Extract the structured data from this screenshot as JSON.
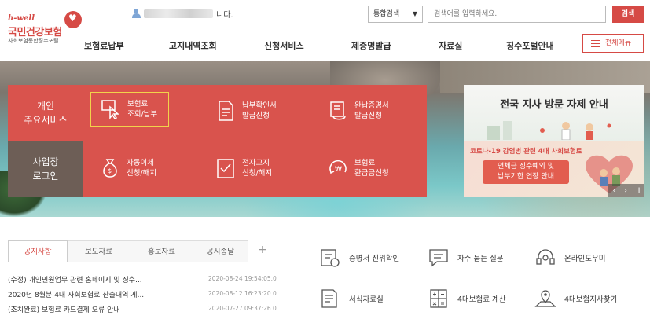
{
  "logo": {
    "brand_en": "h-well",
    "name": "국민건강보험",
    "subtitle": "사회보험통합징수포털"
  },
  "user": {
    "suffix": "니다."
  },
  "search": {
    "scope": "통합검색",
    "placeholder": "검색어를 입력하세요.",
    "button": "검색"
  },
  "nav": {
    "items": [
      "보험료납부",
      "고지내역조회",
      "신청서비스",
      "제증명발급",
      "자료실",
      "징수포털안내"
    ],
    "menu_button": "전체메뉴"
  },
  "personal": {
    "label_line1": "개인",
    "label_line2": "주요서비스",
    "services": [
      {
        "line1": "보험료",
        "line2": "조회/납부",
        "icon": "cursor-click-icon"
      },
      {
        "line1": "납부확인서",
        "line2": "발급신청",
        "icon": "document-icon"
      },
      {
        "line1": "완납증명서",
        "line2": "발급신청",
        "icon": "certificate-scroll-icon"
      }
    ]
  },
  "business": {
    "label_line1": "사업장",
    "label_line2": "로그인",
    "services": [
      {
        "line1": "자동이체",
        "line2": "신청/해지",
        "icon": "money-bag-icon"
      },
      {
        "line1": "전자고지",
        "line2": "신청/해지",
        "icon": "checklist-icon"
      },
      {
        "line1": "보험료",
        "line2": "환급금신청",
        "icon": "refund-icon"
      }
    ]
  },
  "banner": {
    "title": "전국 지사 방문 자제 안내",
    "subtitle": "코로나-19 감염병 관련 4대 사회보험료",
    "body_line1": "연체금 징수예외 및",
    "body_line2": "납부기한 연장 안내",
    "controls": {
      "prev": "‹",
      "next": "›",
      "pause": "II"
    }
  },
  "tabs": [
    "공지사항",
    "보도자료",
    "홍보자료",
    "공시송달"
  ],
  "tab_add": "+",
  "news": [
    {
      "title": "(수정) 개인민원업무 관련 홈페이지 및 징수...",
      "date": "2020-08-24 19:54:05.0"
    },
    {
      "title": "2020년 8월분 4대 사회보험료 산출내역 게...",
      "date": "2020-08-12 16:23:20.0"
    },
    {
      "title": "(조치완료) 보험료 카드결제 오류 안내",
      "date": "2020-07-27 09:37:26.0"
    }
  ],
  "quick_links": [
    {
      "label": "증명서 진위확인",
      "icon": "certificate-check-icon"
    },
    {
      "label": "자주 묻는 질문",
      "icon": "chat-icon"
    },
    {
      "label": "온라인도우미",
      "icon": "headset-icon"
    },
    {
      "label": "서식자료실",
      "icon": "forms-icon"
    },
    {
      "label": "4대보험료 계산",
      "icon": "calculator-icon"
    },
    {
      "label": "4대보험지사찾기",
      "icon": "map-pin-icon"
    }
  ],
  "colors": {
    "accent": "#d9534d",
    "business_label_bg": "#6d5e56",
    "highlight": "#f2d34b"
  }
}
